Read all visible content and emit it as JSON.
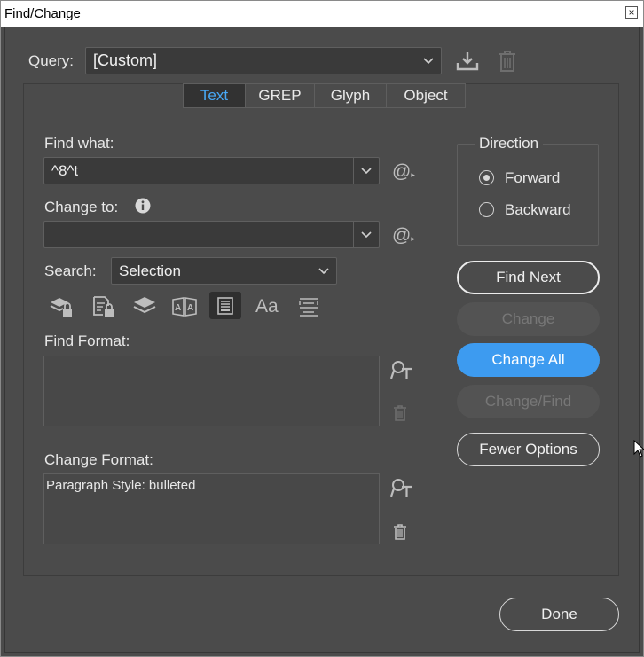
{
  "window": {
    "title": "Find/Change",
    "close": "×"
  },
  "query": {
    "label": "Query:",
    "value": "[Custom]"
  },
  "tabs": [
    {
      "label": "Text",
      "active": true
    },
    {
      "label": "GREP",
      "active": false
    },
    {
      "label": "Glyph",
      "active": false
    },
    {
      "label": "Object",
      "active": false
    }
  ],
  "find_what": {
    "label": "Find what:",
    "value": "^8^t"
  },
  "change_to": {
    "label": "Change to:",
    "value": ""
  },
  "search": {
    "label": "Search:",
    "value": "Selection"
  },
  "search_options": [
    "include-locked-layers-icon",
    "include-locked-stories-icon",
    "include-hidden-layers-icon",
    "include-master-pages-icon",
    "include-footnotes-icon",
    "case-sensitive-icon",
    "whole-word-icon"
  ],
  "find_format": {
    "label": "Find Format:",
    "value": ""
  },
  "change_format": {
    "label": "Change Format:",
    "value": "Paragraph Style: bulleted"
  },
  "direction": {
    "label": "Direction",
    "forward": "Forward",
    "backward": "Backward",
    "selected": "Forward"
  },
  "buttons": {
    "find_next": "Find Next",
    "change": "Change",
    "change_all": "Change All",
    "change_find": "Change/Find",
    "fewer_options": "Fewer Options",
    "done": "Done"
  },
  "colors": {
    "accent": "#3d9bf0",
    "panel": "#4b4b4b",
    "active_tab_text": "#48a8f5"
  }
}
